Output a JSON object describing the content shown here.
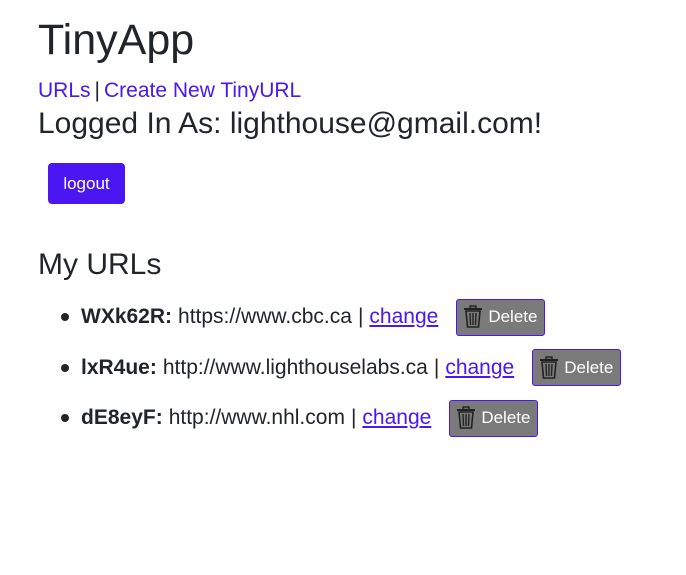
{
  "app": {
    "title": "TinyApp"
  },
  "nav": {
    "urls_label": "URLs",
    "separator": "|",
    "create_label": "Create New TinyURL"
  },
  "user": {
    "logged_in_text": "Logged In As: lighthouse@gmail.com!"
  },
  "logout": {
    "label": "logout"
  },
  "my_urls": {
    "title": "My URLs",
    "items": [
      {
        "short": "WXk62R:",
        "long": "https://www.cbc.ca",
        "sep": "|",
        "change": "change",
        "delete": "Delete"
      },
      {
        "short": "lxR4ue:",
        "long": "http://www.lighthouselabs.ca",
        "sep": "|",
        "change": "change",
        "delete": "Delete"
      },
      {
        "short": "dE8eyF:",
        "long": "http://www.nhl.com",
        "sep": "|",
        "change": "change",
        "delete": "Delete"
      }
    ]
  },
  "colors": {
    "accent": "#4a17f2",
    "delete_bg": "#7a7a7a",
    "text": "#212529"
  },
  "icons": {
    "delete": "trash-icon"
  }
}
